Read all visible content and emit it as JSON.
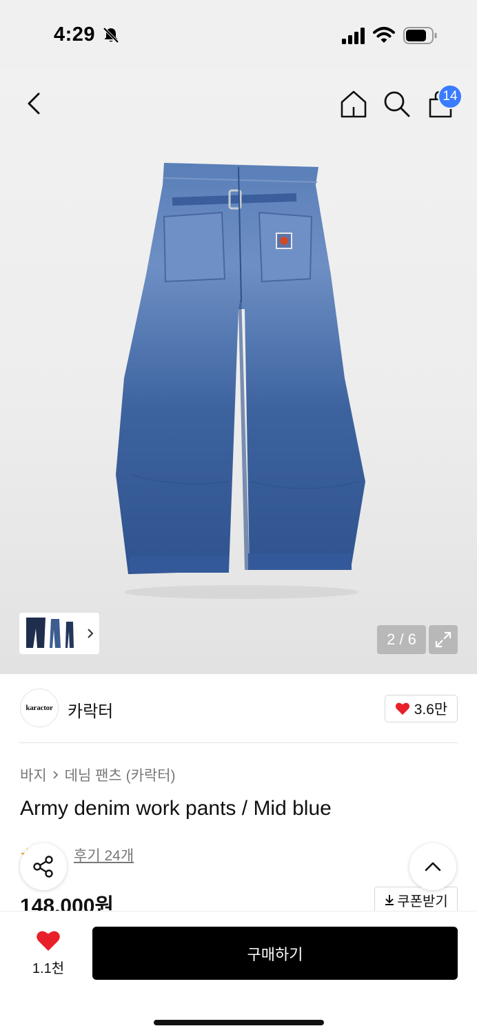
{
  "status_bar": {
    "time": "4:29",
    "icons": [
      "bell-off-icon",
      "signal-icon",
      "wifi-icon",
      "battery-icon"
    ]
  },
  "nav": {
    "icons": [
      "back-icon",
      "home-icon",
      "search-icon",
      "cart-icon"
    ],
    "cart_count": "14"
  },
  "gallery": {
    "counter": "2 / 6",
    "thumbnail_icon": "chevron-right-icon",
    "expand_icon": "expand-icon"
  },
  "brand": {
    "logo_text": "karactor",
    "name": "카락터",
    "like_count": "3.6만"
  },
  "product": {
    "breadcrumb": [
      "바지",
      "데님 팬츠 (카락터)"
    ],
    "title": "Army denim work pants / Mid blue",
    "review_link": "후기 24개",
    "price": "148,000원",
    "coupon_label": "쿠폰받기"
  },
  "bottom_bar": {
    "wish_count": "1.1천",
    "buy_label": "구매하기"
  },
  "colors": {
    "accent_badge": "#3a7bff",
    "heart": "#e8202a",
    "buy_button": "#000000",
    "denim": "#3f64a0"
  }
}
